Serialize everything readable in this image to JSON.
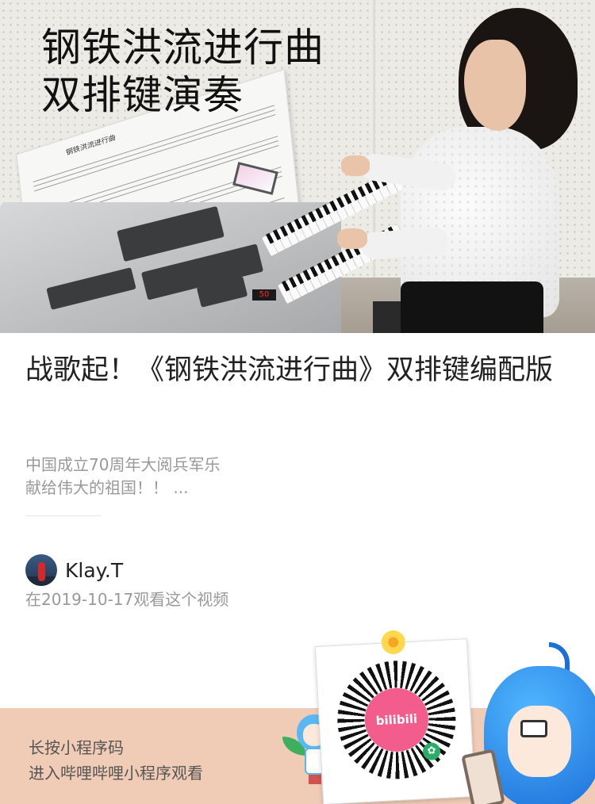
{
  "cover": {
    "overlay_title_line1": "钢铁洪流进行曲",
    "overlay_title_line2": "双排键演奏",
    "sheet_music_title": "钢铁洪流进行曲",
    "display_value": "50"
  },
  "article": {
    "title": "战歌起！《钢铁洪流进行曲》双排键编配版",
    "summary_line1": "中国成立70周年大阅兵军乐",
    "summary_line2": "献给伟大的祖国！！ ..."
  },
  "author": {
    "name": "Klay.T",
    "avatar_icon": "avatar-photo",
    "watch_note": "在2019-10-17观看这个视频"
  },
  "footer": {
    "line1": "长按小程序码",
    "line2": "进入哔哩哔哩小程序观看",
    "qr_logo": "bilibili",
    "background_color": "#f0cbb6",
    "brand_color": "#f25d8e"
  }
}
